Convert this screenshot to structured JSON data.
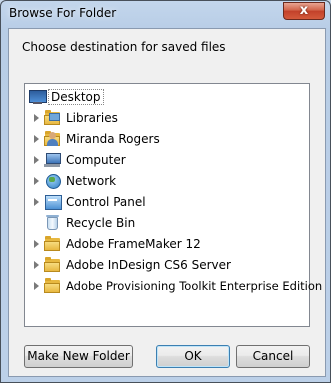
{
  "window": {
    "title": "Browse For Folder",
    "close_glyph": "x",
    "close_color": "#c2412a"
  },
  "dialog": {
    "prompt": "Choose destination for saved files"
  },
  "tree": {
    "items": [
      {
        "label": "Desktop",
        "icon": "desktop-icon",
        "expandable": false,
        "selected": true,
        "depth": 0
      },
      {
        "label": "Libraries",
        "icon": "libraries-icon",
        "expandable": true,
        "selected": false,
        "depth": 1
      },
      {
        "label": "Miranda Rogers",
        "icon": "user-folder-icon",
        "expandable": true,
        "selected": false,
        "depth": 1
      },
      {
        "label": "Computer",
        "icon": "computer-icon",
        "expandable": true,
        "selected": false,
        "depth": 1
      },
      {
        "label": "Network",
        "icon": "network-icon",
        "expandable": true,
        "selected": false,
        "depth": 1
      },
      {
        "label": "Control Panel",
        "icon": "control-panel-icon",
        "expandable": true,
        "selected": false,
        "depth": 1
      },
      {
        "label": "Recycle Bin",
        "icon": "recycle-bin-icon",
        "expandable": false,
        "selected": false,
        "depth": 1
      },
      {
        "label": "Adobe FrameMaker 12",
        "icon": "folder-icon",
        "expandable": true,
        "selected": false,
        "depth": 1
      },
      {
        "label": "Adobe InDesign CS6 Server",
        "icon": "folder-icon",
        "expandable": true,
        "selected": false,
        "depth": 1
      },
      {
        "label": "Adobe Provisioning Toolkit Enterprise Edition",
        "icon": "folder-icon",
        "expandable": true,
        "selected": false,
        "depth": 1
      }
    ]
  },
  "buttons": {
    "new_folder": "Make New Folder",
    "ok": "OK",
    "cancel": "Cancel"
  }
}
